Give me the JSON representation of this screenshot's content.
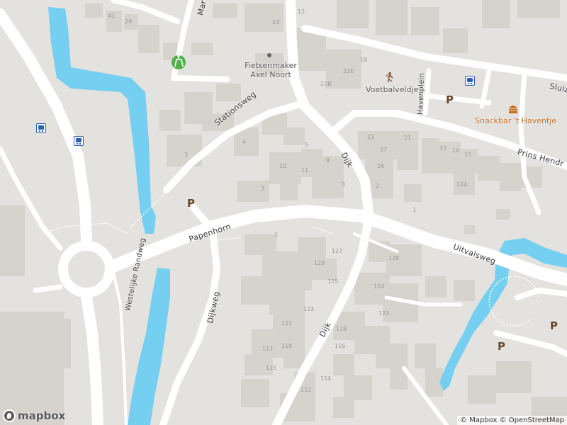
{
  "colors": {
    "land": "#e4e2df",
    "road": "#ffffff",
    "building": "#d6d2cc",
    "water": "#75cff0",
    "park_pin": "#52b04a",
    "bus": "#2f5fb3",
    "poi": "#c86a1b"
  },
  "streets": {
    "stationsweg": "Stationsweg",
    "papenhorn": "Papenhorn",
    "uitvalsweg": "Uitvalsweg",
    "dijkweg": "Dijkweg",
    "dijk_north": "Dijk",
    "dijk_south": "Dijk",
    "westelijke_randweg": "Westelijke Randweg",
    "havenplein": "Havenplein",
    "prins_hendrik": "Prins Hendr",
    "sluis": "Sluiz",
    "mar": "Mar"
  },
  "pois": {
    "fietsenmaker_line1": "Fietsenmaker",
    "fietsenmaker_line2": "Axel Noort",
    "voetbalveldje": "Voetbalveldje",
    "snackbar": "Snackbar 't Haventje"
  },
  "icons": {
    "parking": "P",
    "bus_stop": "bus-stop-icon",
    "playground": "playground-icon",
    "soccer": "soccer-icon",
    "food": "fast-food-icon",
    "shop": "shop-dot-icon"
  },
  "house_numbers": [
    "41",
    "29",
    "23",
    "12",
    "18",
    "22E",
    "22B",
    "4",
    "3",
    "10",
    "11",
    "9",
    "3",
    "5",
    "3",
    "2",
    "23",
    "21",
    "27",
    "26",
    "17",
    "16",
    "15",
    "12A",
    "1",
    "2",
    "127",
    "129",
    "128",
    "125",
    "124",
    "122",
    "121",
    "123",
    "119",
    "117",
    "118",
    "116",
    "115",
    "112",
    "114"
  ],
  "branding": {
    "logo_text": "mapbox"
  },
  "attribution": "© Mapbox © OpenStreetMap"
}
